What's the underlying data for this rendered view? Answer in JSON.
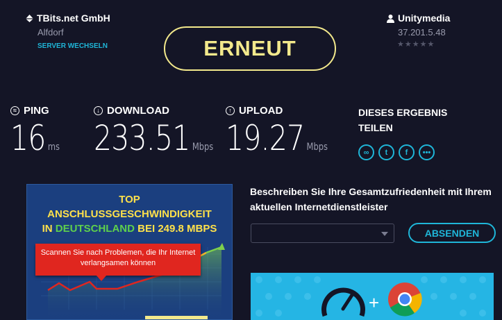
{
  "server": {
    "name": "TBits.net GmbH",
    "location": "Alfdorf",
    "change_label": "SERVER WECHSELN",
    "icon": "server-icon"
  },
  "isp": {
    "name": "Unitymedia",
    "ip": "37.201.5.48",
    "rating_stars": "★★★★★",
    "rating": 0,
    "icon": "user-icon"
  },
  "again_label": "ERNEUT",
  "metrics": {
    "ping": {
      "label": "PING",
      "value": "16",
      "unit": "ms",
      "icon": "ping-icon"
    },
    "download": {
      "label": "DOWNLOAD",
      "value": "233.51",
      "unit": "Mbps",
      "icon": "download-icon"
    },
    "upload": {
      "label": "UPLOAD",
      "value": "19.27",
      "unit": "Mbps",
      "icon": "upload-icon"
    }
  },
  "share": {
    "title": "DIESES ERGEBNIS TEILEN",
    "icons": [
      "link-icon",
      "twitter-icon",
      "facebook-icon",
      "more-icon"
    ]
  },
  "ad_banner": {
    "line1": "TOP",
    "line2": "ANSCHLUSSGESCHWINDIGKEIT",
    "line3_prefix": "IN",
    "line3_highlight": "DEUTSCHLAND",
    "line3_suffix": "BEI 249.8 MBPS",
    "warning": "Scannen Sie nach Problemen, die Ihr Internet verlangsamen können"
  },
  "survey": {
    "question": "Beschreiben Sie Ihre Gesamtzufriedenheit mit Ihrem aktuellen Internetdienstleister",
    "dropdown_value": "",
    "submit_label": "ABSENDEN"
  },
  "colors": {
    "background": "#141526",
    "accent": "#1fb6d8",
    "button": "#f3e98c"
  }
}
